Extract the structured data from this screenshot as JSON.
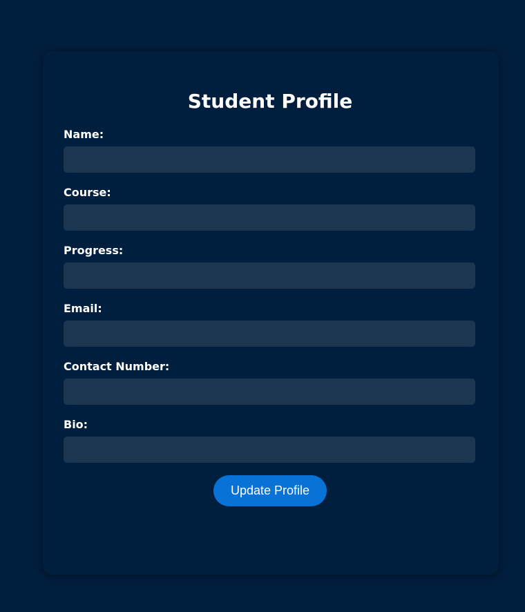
{
  "page": {
    "title": "Student Profile"
  },
  "form": {
    "fields": [
      {
        "label": "Name:",
        "value": ""
      },
      {
        "label": "Course:",
        "value": ""
      },
      {
        "label": "Progress:",
        "value": ""
      },
      {
        "label": "Email:",
        "value": ""
      },
      {
        "label": "Contact Number:",
        "value": ""
      },
      {
        "label": "Bio:",
        "value": ""
      }
    ],
    "submit_label": "Update Profile"
  },
  "colors": {
    "background": "#001e3d",
    "input_background": "#1c3652",
    "accent": "#0872d6",
    "text": "#ffffff"
  }
}
